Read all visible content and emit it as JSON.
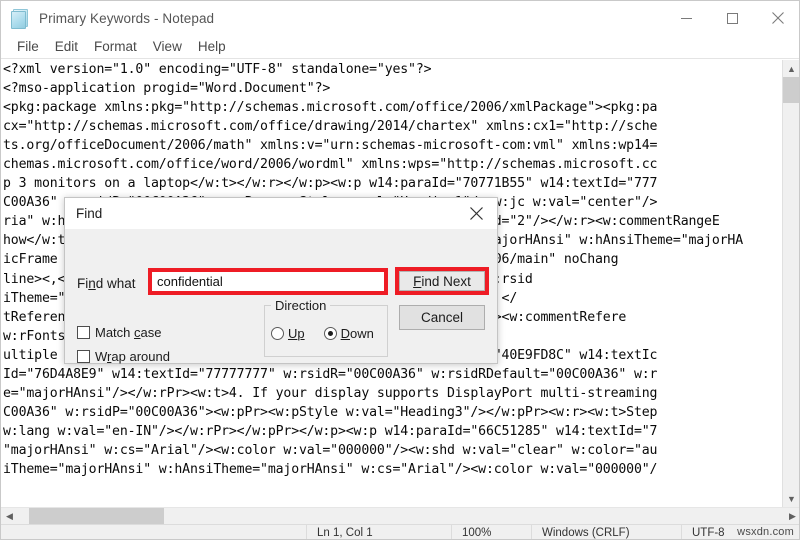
{
  "window": {
    "title": "Primary Keywords - Notepad",
    "icon": "notepad-icon",
    "minimize_label": "Minimize",
    "maximize_label": "Maximize",
    "close_label": "Close"
  },
  "menu": {
    "items": [
      "File",
      "Edit",
      "Format",
      "View",
      "Help"
    ]
  },
  "editor": {
    "lines": [
      "<?xml version=\"1.0\" encoding=\"UTF-8\" standalone=\"yes\"?>",
      "<?mso-application progid=\"Word.Document\"?>",
      "<pkg:package xmlns:pkg=\"http://schemas.microsoft.com/office/2006/xmlPackage\"><pkg:pa",
      "cx=\"http://schemas.microsoft.com/office/drawing/2014/chartex\" xmlns:cx1=\"http://sche",
      "ts.org/officeDocument/2006/math\" xmlns:v=\"urn:schemas-microsoft-com:vml\" xmlns:wp14=",
      "chemas.microsoft.com/office/word/2006/wordml\" xmlns:wps=\"http://schemas.microsoft.cc",
      "p 3 monitors on a laptop</w:t></w:r></w:p><w:p w14:paraId=\"70771B55\" w14:textId=\"777",
      "C00A36\" w:rsidP=\"00C00A36\"><w:pPr><w:pStyle w:val=\"Heading1\"/><w:jc w:val=\"center\"/>",
      "ria\" w:hAnsiTheme=\"majorHAnsi\"/></w:rPr><w:commentReference w:id=\"2\"/></w:r><w:commentRangeE",
      "how</w:t></w:r></w:p><w:p><w:r><w:rPr><w:rFonts w:asciiTheme=\"majorHAnsi\" w:hAnsiTheme=\"majorHA",
      "icFrame xmlns:a=\"http://schemas.openxmlformats.org/drawingml/2006/main\" noChang",
      "line><,</w:p><w:p w14:paraId=\"1F3D9A10\" w14:textId=\"4621A81C\" w:rsid",
      "iTheme=\"majorHAnsi\" w:hAnsi/></w:rPr><w:t xml:space=\"preserve\"> </",
      "tReference w:id=\"3\"/></w:r><w:rFonts w:ascii=\"Cambria\"/></w:rPr><w:commentRefere",
      "w:rFonts w:asciiTheme=\"majorHAnsi\"/></w:rPr></w:pPr><w:r><",
      "ultiple monitors with laptop.</w:t></w:r></w:p><w:p w14:paraId=\"40E9FD8C\" w14:textIc",
      "Id=\"76D4A8E9\" w14:textId=\"77777777\" w:rsidR=\"00C00A36\" w:rsidRDefault=\"00C00A36\" w:r",
      "e=\"majorHAnsi\"/></w:rPr><w:t>4. If your display supports DisplayPort multi-streaming",
      "C00A36\" w:rsidP=\"00C00A36\"><w:pPr><w:pStyle w:val=\"Heading3\"/></w:pPr><w:r><w:t>Step",
      "w:lang w:val=\"en-IN\"/></w:rPr></w:pPr></w:p><w:p w14:paraId=\"66C51285\" w14:textId=\"7",
      "\"majorHAnsi\" w:cs=\"Arial\"/><w:color w:val=\"000000\"/><w:shd w:val=\"clear\" w:color=\"au",
      "iTheme=\"majorHAnsi\" w:hAnsiTheme=\"majorHAnsi\" w:cs=\"Arial\"/><w:color w:val=\"000000\"/"
    ]
  },
  "find_dialog": {
    "title": "Find",
    "close_label": "Close",
    "find_what_label_pre": "Fi",
    "find_what_label_mid": "n",
    "find_what_label_post": "d what",
    "find_what_value": "confidential",
    "find_what_placeholder": "",
    "find_next_pre": "",
    "find_next_accel": "F",
    "find_next_rest": "ind Next",
    "cancel_label": "Cancel",
    "direction_label": "Direction",
    "direction_options": [
      {
        "label_pre": "U",
        "label_accel": "p",
        "label_post": "",
        "selected": false
      },
      {
        "label_pre": "",
        "label_accel": "D",
        "label_post": "own",
        "selected": true
      }
    ],
    "match_case_pre": "Match ",
    "match_case_accel": "c",
    "match_case_post": "ase",
    "match_case_checked": false,
    "wrap_around_pre": "W",
    "wrap_around_accel": "r",
    "wrap_around_post": "ap around",
    "wrap_around_checked": false,
    "highlight_color": "#ee1c25"
  },
  "statusbar": {
    "position": "Ln 1, Col 1",
    "zoom": "100%",
    "line_ending": "Windows (CRLF)",
    "encoding": "UTF-8"
  },
  "watermark": {
    "text": "wsxdn.com"
  }
}
